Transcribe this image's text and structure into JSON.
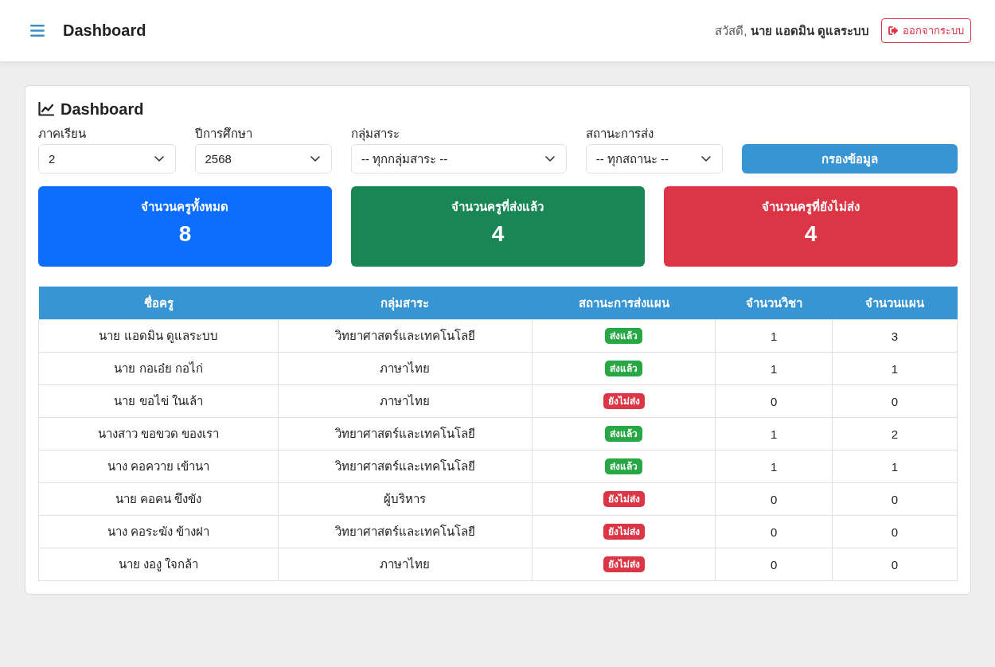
{
  "header": {
    "title": "Dashboard",
    "greeting": "สวัสดี, **นาย แอดมิน ดูแลระบบ**",
    "logout_button": "ออกจากระบบ"
  },
  "card": {
    "title": "Dashboard",
    "filters": [
      {
        "label": "ภาคเรียน",
        "value": "2"
      },
      {
        "label": "ปีการศึกษา",
        "value": "2568"
      },
      {
        "label": "กลุ่มสาระ",
        "value": "-- ทุกกลุ่มสาระ --"
      },
      {
        "label": "สถานะการส่ง",
        "value": "-- ทุกสถานะ --"
      }
    ],
    "filter_button": "กรองข้อมูล",
    "stats": [
      {
        "label": "จำนวนครูทั้งหมด",
        "value": "8",
        "color": "#0d6efd"
      },
      {
        "label": "จำนวนครูที่ส่งแล้ว",
        "value": "4",
        "color": "#198754"
      },
      {
        "label": "จำนวนครูที่ยังไม่ส่ง",
        "value": "4",
        "color": "#dc3545"
      }
    ],
    "table": {
      "columns": [
        "ชื่อครู",
        "กลุ่มสาระ",
        "สถานะการส่งแผน",
        "จำนวนวิชา",
        "จำนวนแผน"
      ],
      "rows": [
        {
          "name": "นาย แอดมิน ดูแลระบบ",
          "subject_group": "วิทยาศาสตร์และเทคโนโลยี",
          "status": {
            "label": "ส่งแล้ว",
            "color": "#28a745"
          },
          "subject_count": "1",
          "plan_count": "3"
        },
        {
          "name": "นาย กอเอ๋ย กอไก่",
          "subject_group": "ภาษาไทย",
          "status": {
            "label": "ส่งแล้ว",
            "color": "#28a745"
          },
          "subject_count": "1",
          "plan_count": "1"
        },
        {
          "name": "นาย ขอไข่ ในเล้า",
          "subject_group": "ภาษาไทย",
          "status": {
            "label": "ยังไม่ส่ง",
            "color": "#dc3545"
          },
          "subject_count": "0",
          "plan_count": "0"
        },
        {
          "name": "นางสาว ขอขวด ของเรา",
          "subject_group": "วิทยาศาสตร์และเทคโนโลยี",
          "status": {
            "label": "ส่งแล้ว",
            "color": "#28a745"
          },
          "subject_count": "1",
          "plan_count": "2"
        },
        {
          "name": "นาง คอควาย เข้านา",
          "subject_group": "วิทยาศาสตร์และเทคโนโลยี",
          "status": {
            "label": "ส่งแล้ว",
            "color": "#28a745"
          },
          "subject_count": "1",
          "plan_count": "1"
        },
        {
          "name": "นาย คอคน ขึงขัง",
          "subject_group": "ผู้บริหาร",
          "status": {
            "label": "ยังไม่ส่ง",
            "color": "#dc3545"
          },
          "subject_count": "0",
          "plan_count": "0"
        },
        {
          "name": "นาง คอระฆัง ข้างฝา",
          "subject_group": "วิทยาศาสตร์และเทคโนโลยี",
          "status": {
            "label": "ยังไม่ส่ง",
            "color": "#dc3545"
          },
          "subject_count": "0",
          "plan_count": "0"
        },
        {
          "name": "นาย งองู ใจกล้า",
          "subject_group": "ภาษาไทย",
          "status": {
            "label": "ยังไม่ส่ง",
            "color": "#dc3545"
          },
          "subject_count": "0",
          "plan_count": "0"
        }
      ]
    }
  }
}
